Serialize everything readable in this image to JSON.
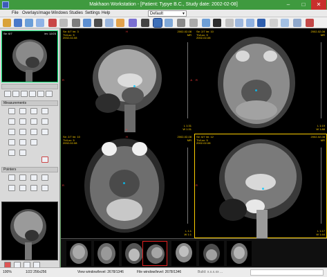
{
  "window": {
    "title": "Makhaon Workstation - [Patient: Typye B.C., Study date: 2002-02-08]",
    "min": "–",
    "max": "□",
    "close": "✕"
  },
  "menu": {
    "items": [
      "File",
      "Overlays",
      "Image",
      "Windows",
      "Studies",
      "Settings",
      "Help"
    ],
    "preset": "Default"
  },
  "left_panel": {
    "top_thumb": {
      "tl": "Se: 6/7",
      "tr": "Im: 12/23"
    },
    "measurements_label": "Measurements",
    "pointers_label": "Pointers"
  },
  "viewports": [
    {
      "id": "vp1",
      "tl": [
        "Se: 6/7 Im: 3",
        "Th/Loc: 5",
        "2002-02-08"
      ],
      "tr": [
        "2002-02-08",
        "MR",
        "..."
      ],
      "br": [
        "L 1:31",
        "W 1:31"
      ]
    },
    {
      "id": "vp2",
      "tl": [
        "Se: 2/7 Im: 10",
        "Th/Loc: 5",
        "2002-02-08"
      ],
      "tr": [
        "2002-02-08",
        "MR",
        "..."
      ],
      "br": [
        "L 1:19",
        "W 1:88"
      ]
    },
    {
      "id": "vp3",
      "tl": [
        "Se: 2/7 Im: 10",
        "Th/Loc: 5",
        "2002-02-08"
      ],
      "tr": [
        "2002-02-08",
        "MR",
        "..."
      ],
      "br": [
        "L 1:1",
        "W 1:1"
      ]
    },
    {
      "id": "vp4",
      "tl": [
        "Se: 6/7 Im: 12",
        "Th/Loc: 5",
        "2002-02-08"
      ],
      "tr": [
        "2002-02-08",
        "MR",
        "..."
      ],
      "br": [
        "L 1:17",
        "W 1:44"
      ]
    }
  ],
  "orientation": {
    "top": "H",
    "left": "R",
    "right": "A",
    "bottom": "F"
  },
  "status": {
    "zoom": "100%",
    "image_info": "1/22 256x256",
    "view_wl": "View window/level: 2678/1346",
    "file_wl": "File window/level: 2678/1346",
    "version": "Build: x.x.x.xx  ..."
  }
}
